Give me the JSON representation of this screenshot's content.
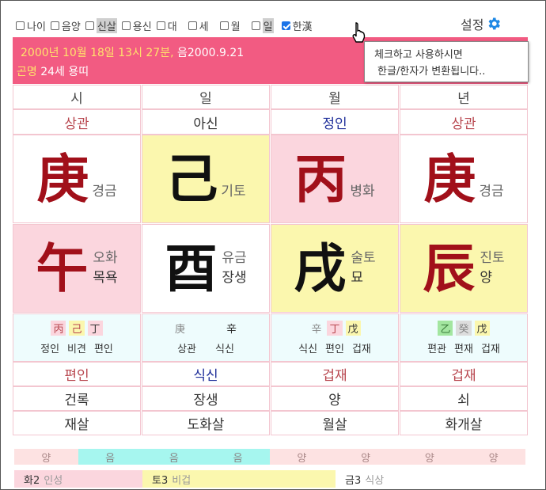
{
  "toolbar": {
    "options": [
      {
        "label": "나이",
        "checked": false
      },
      {
        "label": "음양",
        "checked": false
      },
      {
        "label": "신살",
        "checked": false,
        "highlight": true
      },
      {
        "label": "용신",
        "checked": false
      },
      {
        "label": "대",
        "checked": false
      },
      {
        "label": "세",
        "checked": false
      },
      {
        "label": "월",
        "checked": false
      },
      {
        "label": "일",
        "checked": false
      },
      {
        "label": "한漢",
        "checked": true
      }
    ],
    "settings_label": "설정"
  },
  "tooltip": {
    "line1": "체크하고 사용하시면",
    "line2": "한글/한자가 변환됩니다.."
  },
  "header": {
    "date_part1": "2000년 10월 18일 13시 27분,",
    "date_part2": " 음2000.9.21",
    "gender": "곤명",
    "age_info": " 24세 용띠"
  },
  "columns": [
    "시",
    "일",
    "월",
    "년"
  ],
  "tengods_top": [
    "상관",
    "아신",
    "정인",
    "상관"
  ],
  "stems": [
    {
      "hanja": "庚",
      "reading": "경금"
    },
    {
      "hanja": "己",
      "reading": "기토"
    },
    {
      "hanja": "丙",
      "reading": "병화"
    },
    {
      "hanja": "庚",
      "reading": "경금"
    }
  ],
  "branches": [
    {
      "hanja": "午",
      "reading": "오화",
      "stage": "목욕"
    },
    {
      "hanja": "酉",
      "reading": "유금",
      "stage": "장생"
    },
    {
      "hanja": "戌",
      "reading": "술토",
      "stage": "묘"
    },
    {
      "hanja": "辰",
      "reading": "진토",
      "stage": "양"
    }
  ],
  "hidden_stems": [
    {
      "chars": [
        "丙",
        "己",
        "丁"
      ],
      "gods": [
        "정인",
        "비견",
        "편인"
      ]
    },
    {
      "chars": [
        "庚",
        "辛"
      ],
      "gods": [
        "상관",
        "식신"
      ]
    },
    {
      "chars": [
        "辛",
        "丁",
        "戊"
      ],
      "gods": [
        "식신",
        "편인",
        "겁재"
      ]
    },
    {
      "chars": [
        "乙",
        "癸",
        "戊"
      ],
      "gods": [
        "편관",
        "편재",
        "겁재"
      ]
    }
  ],
  "tengods_bottom": [
    "편인",
    "식신",
    "겁재",
    "겁재"
  ],
  "stages": [
    "건록",
    "장생",
    "양",
    "쇠"
  ],
  "sinsal": [
    "재살",
    "도화살",
    "월살",
    "화개살"
  ],
  "yinyang": [
    "양",
    "음",
    "음",
    "음",
    "양",
    "양",
    "양",
    "양"
  ],
  "elements": [
    {
      "name": "화2",
      "desc": "인성"
    },
    {
      "name": "토3",
      "desc": "비겁"
    },
    {
      "name": "금3",
      "desc": "식상"
    }
  ]
}
